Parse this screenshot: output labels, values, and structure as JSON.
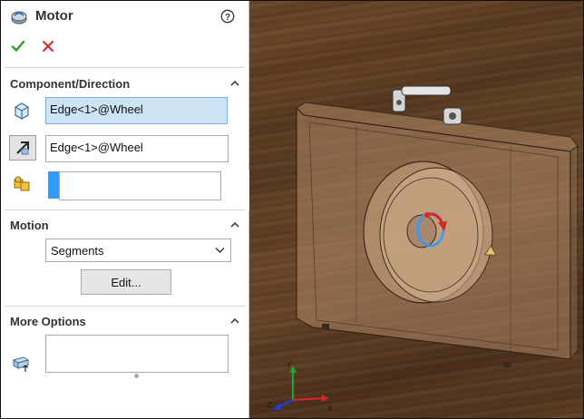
{
  "feature": {
    "title": "Motor"
  },
  "actions": {
    "ok_icon": "check-icon",
    "cancel_icon": "x-icon",
    "help_icon": "help-icon"
  },
  "component_direction": {
    "header": "Component/Direction",
    "component_value": "Edge<1>@Wheel",
    "direction_value": "Edge<1>@Wheel",
    "third_value": ""
  },
  "motion": {
    "header": "Motion",
    "type": "Segments",
    "edit_label": "Edit..."
  },
  "more_options": {
    "header": "More Options",
    "value": ""
  },
  "colors": {
    "accent": "#3399ff",
    "ok": "#2ca02c",
    "cancel": "#d62728",
    "panel_bg": "#ffffff"
  }
}
